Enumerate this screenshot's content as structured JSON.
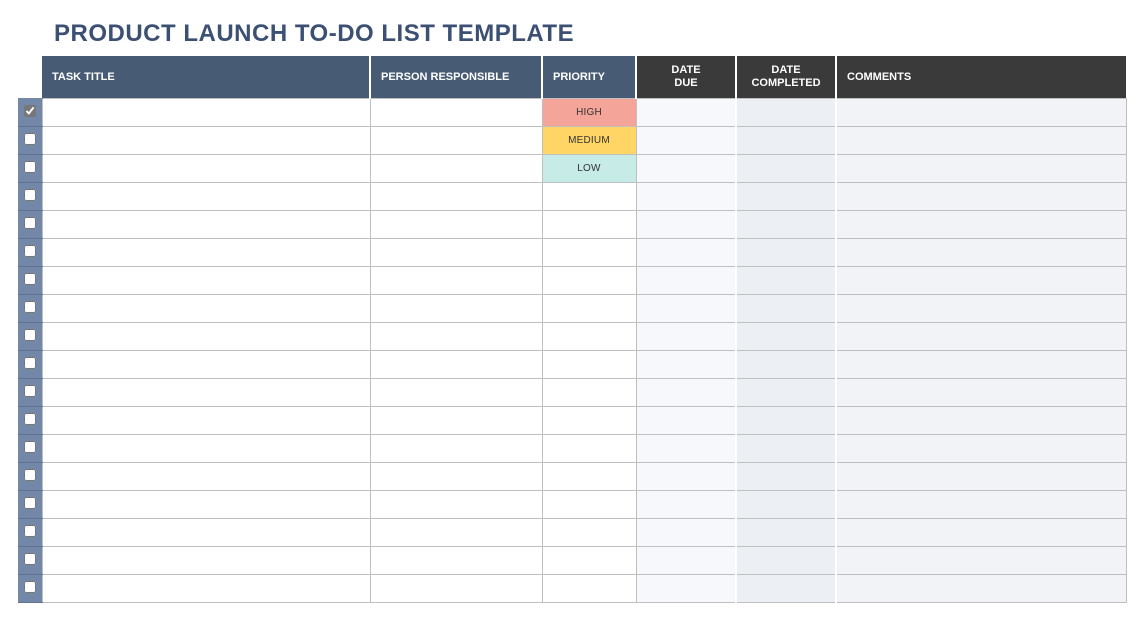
{
  "title": "PRODUCT LAUNCH TO-DO LIST TEMPLATE",
  "columns": {
    "task": "TASK TITLE",
    "person": "PERSON RESPONSIBLE",
    "priority": "PRIORITY",
    "date_due": "DATE\nDUE",
    "date_completed": "DATE\nCOMPLETED",
    "comments": "COMMENTS"
  },
  "priority_levels": {
    "high": "HIGH",
    "medium": "MEDIUM",
    "low": "LOW"
  },
  "rows": [
    {
      "checked": true,
      "task": "",
      "person": "",
      "priority": "high",
      "date_due": "",
      "date_completed": "",
      "comments": ""
    },
    {
      "checked": false,
      "task": "",
      "person": "",
      "priority": "medium",
      "date_due": "",
      "date_completed": "",
      "comments": ""
    },
    {
      "checked": false,
      "task": "",
      "person": "",
      "priority": "low",
      "date_due": "",
      "date_completed": "",
      "comments": ""
    },
    {
      "checked": false,
      "task": "",
      "person": "",
      "priority": "",
      "date_due": "",
      "date_completed": "",
      "comments": ""
    },
    {
      "checked": false,
      "task": "",
      "person": "",
      "priority": "",
      "date_due": "",
      "date_completed": "",
      "comments": ""
    },
    {
      "checked": false,
      "task": "",
      "person": "",
      "priority": "",
      "date_due": "",
      "date_completed": "",
      "comments": ""
    },
    {
      "checked": false,
      "task": "",
      "person": "",
      "priority": "",
      "date_due": "",
      "date_completed": "",
      "comments": ""
    },
    {
      "checked": false,
      "task": "",
      "person": "",
      "priority": "",
      "date_due": "",
      "date_completed": "",
      "comments": ""
    },
    {
      "checked": false,
      "task": "",
      "person": "",
      "priority": "",
      "date_due": "",
      "date_completed": "",
      "comments": ""
    },
    {
      "checked": false,
      "task": "",
      "person": "",
      "priority": "",
      "date_due": "",
      "date_completed": "",
      "comments": ""
    },
    {
      "checked": false,
      "task": "",
      "person": "",
      "priority": "",
      "date_due": "",
      "date_completed": "",
      "comments": ""
    },
    {
      "checked": false,
      "task": "",
      "person": "",
      "priority": "",
      "date_due": "",
      "date_completed": "",
      "comments": ""
    },
    {
      "checked": false,
      "task": "",
      "person": "",
      "priority": "",
      "date_due": "",
      "date_completed": "",
      "comments": ""
    },
    {
      "checked": false,
      "task": "",
      "person": "",
      "priority": "",
      "date_due": "",
      "date_completed": "",
      "comments": ""
    },
    {
      "checked": false,
      "task": "",
      "person": "",
      "priority": "",
      "date_due": "",
      "date_completed": "",
      "comments": ""
    },
    {
      "checked": false,
      "task": "",
      "person": "",
      "priority": "",
      "date_due": "",
      "date_completed": "",
      "comments": ""
    },
    {
      "checked": false,
      "task": "",
      "person": "",
      "priority": "",
      "date_due": "",
      "date_completed": "",
      "comments": ""
    },
    {
      "checked": false,
      "task": "",
      "person": "",
      "priority": "",
      "date_due": "",
      "date_completed": "",
      "comments": ""
    }
  ]
}
